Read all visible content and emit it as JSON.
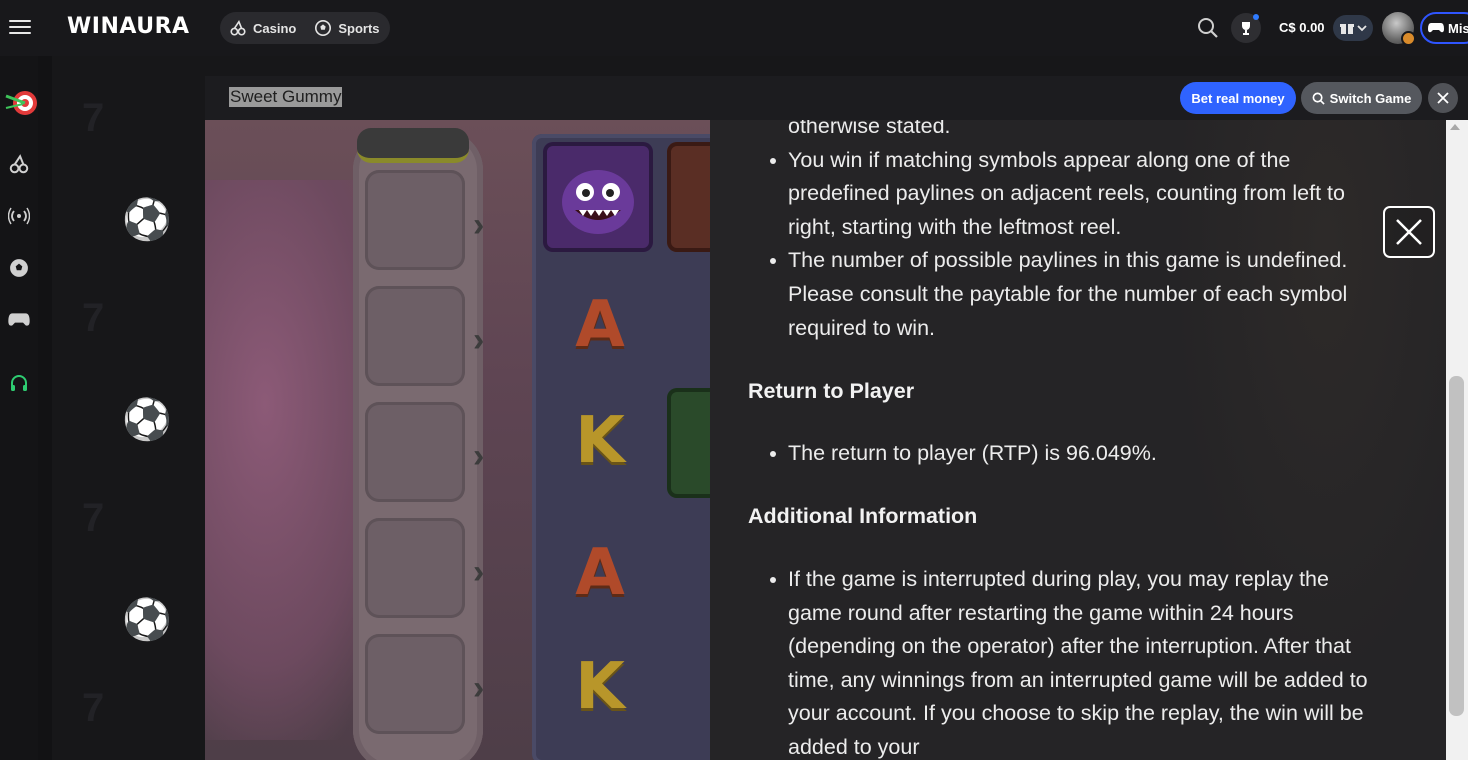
{
  "app": {
    "logo": "WINAURA",
    "nav": [
      {
        "label": "Casino",
        "icon": "cherries-icon"
      },
      {
        "label": "Sports",
        "icon": "soccer-ball-icon"
      }
    ],
    "balance": "C$ 0.00",
    "missions_label": "Mis"
  },
  "sidebar": {
    "items": [
      {
        "name": "target-icon"
      },
      {
        "name": "cherries-icon"
      },
      {
        "name": "live-broadcast-icon"
      },
      {
        "name": "soccer-ball-icon"
      },
      {
        "name": "gamepad-icon"
      },
      {
        "name": "support-headset-icon"
      }
    ]
  },
  "game": {
    "title": "Sweet Gummy",
    "bet_real_label": "Bet real money",
    "switch_label": "Switch Game"
  },
  "slot": {
    "letters": [
      "A",
      "K",
      "A",
      "K"
    ]
  },
  "paytable": {
    "line_top": "otherwise stated.",
    "bullets_rules": [
      "You win if matching symbols appear along one of the predefined paylines on adjacent reels, counting from left to right, starting with the leftmost reel.",
      "The number of possible paylines in this game is undefined. Please consult the paytable for the number of each symbol required to win."
    ],
    "rtp_heading": "Return to Player",
    "rtp_bullet": "The return to player (RTP) is 96.049%.",
    "additional_heading": "Additional Information",
    "additional_bullet": "If the game is interrupted during play, you may replay the game round after restarting the game within 24 hours (depending on the operator) after the interruption. After that time, any winnings from an interrupted game will be added to your account. If you choose to skip the replay, the win will be added to your"
  },
  "colors": {
    "accent_blue": "#2f63ff",
    "topbar": "#18181b",
    "overlay": "#262527"
  }
}
